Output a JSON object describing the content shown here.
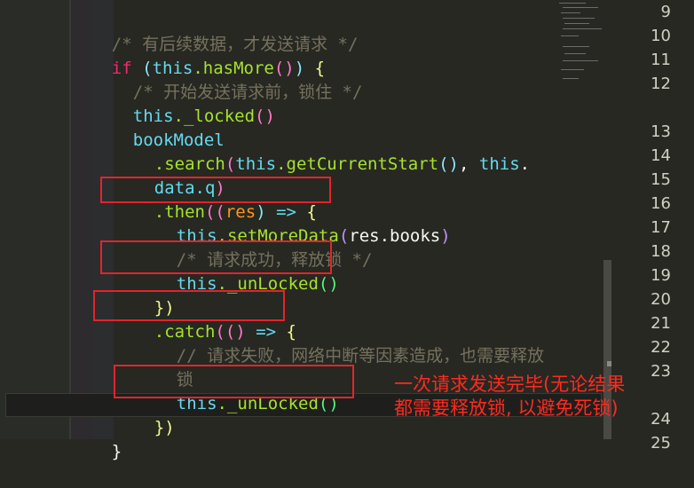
{
  "code": {
    "l1_comment": "/* 有后续数据，才发送请求 */",
    "l2_if": "if",
    "l2_this": "this",
    "l2_dot_method": ".hasMore",
    "l2_open": "(",
    "l2_close": ")",
    "l2_brace": "{",
    "l3_comment": "/* 开始发送请求前，锁住 */",
    "l4_this": "this",
    "l4_method": "._locked",
    "l4_parens": "()",
    "l5_text": "bookModel",
    "l6_method": ".search",
    "l6_this": "this",
    "l6_method2": ".getCurrentStart",
    "l6_parens": "()",
    "l6_comma": ",",
    "l6_this2": "this",
    "l6_dot": ".",
    "l7_text": "data.q",
    "l7_close": ")",
    "l8_method": ".then",
    "l8_open": "((",
    "l8_param": "res",
    "l8_close": ")",
    "l8_arrow": "=>",
    "l8_brace": "{",
    "l9_this": "this",
    "l9_method": ".setMoreData",
    "l9_arg": "res.books",
    "l9_close": ")",
    "l10_comment": "/* 请求成功，释放锁 */",
    "l11_this": "this",
    "l11_method": "._unLocked",
    "l11_parens": "()",
    "l12_close": "})",
    "l13_method": ".catch",
    "l13_open": "(()",
    "l13_arrow": "=>",
    "l13_brace": "{",
    "l14_comment": "// 请求失败，网络中断等因素造成，也需要释放",
    "l15_comment": "锁",
    "l16_this": "this",
    "l16_method": "._unLocked",
    "l16_parens": "()",
    "l17_close": "})",
    "l18_brace": "}"
  },
  "line_numbers": [
    "9",
    "10",
    "11",
    "12",
    "13",
    "14",
    "15",
    "16",
    "17",
    "18",
    "19",
    "20",
    "21",
    "22",
    "23",
    "24",
    "25"
  ],
  "annotation": {
    "line1": "一次请求发送完毕(无论结果",
    "line2": "都需要释放锁, 以避免死锁)"
  },
  "colors": {
    "background": "#272822",
    "highlight_box": "#e3242b",
    "annotation_text": "#ff2a1f"
  }
}
